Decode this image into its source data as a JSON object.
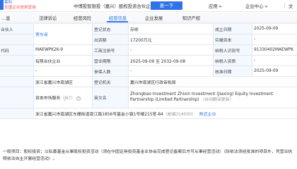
{
  "header": {
    "logo_line1": "客科",
    "logo_line2": "全国企业信用查询",
    "company_title": "中博投智银投（嘉兴）股权投资合伙企业（有限…",
    "search_button": "查一下",
    "nav": [
      "应用",
      "企业中心"
    ],
    "nav_partial": "文"
  },
  "tabs": [
    {
      "label": "…息"
    },
    {
      "label": "法律诉讼"
    },
    {
      "label": "经营风险"
    },
    {
      "label": "经营信息"
    },
    {
      "label": "企业发展"
    },
    {
      "label": "知识产权"
    }
  ],
  "active_tab": 3,
  "table": {
    "r1": {
      "l1": "合伙人",
      "l2": "登记状态",
      "v2": "存续",
      "l3": "成立日期",
      "v3": "2025-09-09"
    },
    "r1b": {
      "v1": "贾东淑",
      "l2": "出资额",
      "v2": "17200万元",
      "l3": "实缴资本",
      "v3": "-"
    },
    "r2": {
      "l1": "代码",
      "v1": "MAEWPK2K-9",
      "l2": "工商注册号",
      "v2": "-",
      "l3": "纳税人识别号",
      "v3": "91330402MAEWPK"
    },
    "r3": {
      "v1": "有限合伙企业",
      "l2": "营业期限",
      "v2": "2025-09-09 至 2032-09-08",
      "l3": "纳税人资质",
      "v3": "-"
    },
    "r4": {
      "v1": "-",
      "l2": "参保人数",
      "v2": "-",
      "l3": "核准日期",
      "v3": "2025-09-09"
    },
    "r5": {
      "v1": "浙江省嘉兴市南湖区",
      "l2": "登记机关",
      "v2": "嘉兴市南湖区行政审批局"
    },
    "r6": {
      "tag": "J67",
      "v1": "资本市场服务",
      "l2": "英文名",
      "v2": "Zhongbao Investment Zhixin Investment (Jiaxing) Equity Investment Partnership (Limited Partnership)",
      "v2_note": "（自动翻译更新）"
    },
    "r7": {
      "v1": "浙江省嘉兴市南湖区东栅街道南江路1856号基金小镇1号楼215室-84",
      "note": "（邮编314000）",
      "link": "附近企业"
    }
  },
  "scope": "一般项目：股权投资；以私募基金从事股权投资活动（须在中国证券投资基金业协会完成登记备案后方可从事经营活动）（除依法须经批准的项目外，凭营业执照依法自主开展经营活动）。"
}
